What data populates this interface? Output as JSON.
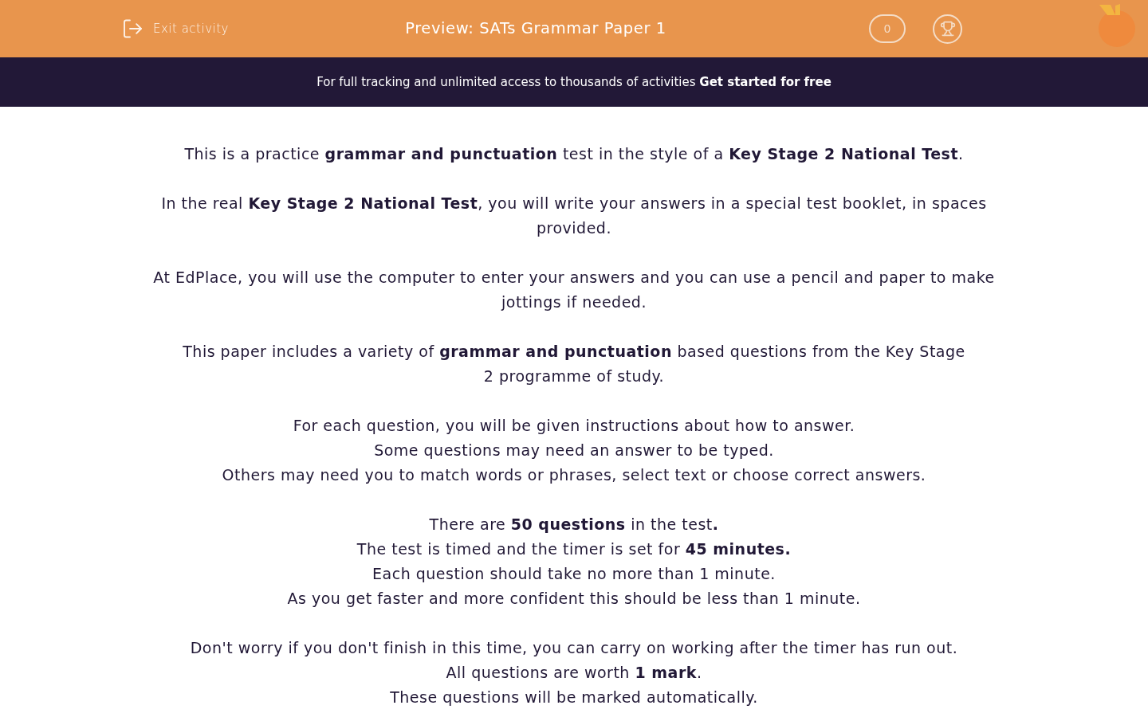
{
  "header": {
    "exit_label": "Exit activity",
    "title": "Preview: SATs Grammar Paper 1",
    "score": "0"
  },
  "banner": {
    "text": "For full tracking and unlimited access to thousands of activities",
    "link": "Get started for free"
  },
  "paragraphs": [
    {
      "lines": [
        "This is a practice **grammar and punctuation** test in the style of a **Key Stage 2 National Test**."
      ]
    },
    {
      "lines": [
        "In the real **Key Stage 2 National Test**, you will write your answers in a special test booklet, in spaces",
        "provided."
      ]
    },
    {
      "lines": [
        "At EdPlace, you will use the computer to enter your answers and you can use a pencil and paper to make",
        "jottings if needed."
      ]
    },
    {
      "lines": [
        "This paper includes a variety of **grammar and punctuation** based questions from the Key Stage",
        "2 programme of study."
      ]
    },
    {
      "lines": [
        "For each question, you will be given instructions about how to answer.",
        "Some questions may need an answer to be typed.",
        "Others may need you to match words or phrases, select text or choose correct answers."
      ]
    },
    {
      "lines": [
        "There are **50 questions** in the test**.**",
        "The test is timed and the timer is set for **45 minutes.**",
        "Each question should take no more than 1 minute.",
        "As you get faster and more confident this should be less than 1 minute."
      ]
    },
    {
      "lines": [
        "Don't worry if you don't finish in this time, you can carry on working after the timer has run out.",
        "All questions are worth **1 mark**.",
        "These questions will be marked automatically."
      ]
    }
  ]
}
